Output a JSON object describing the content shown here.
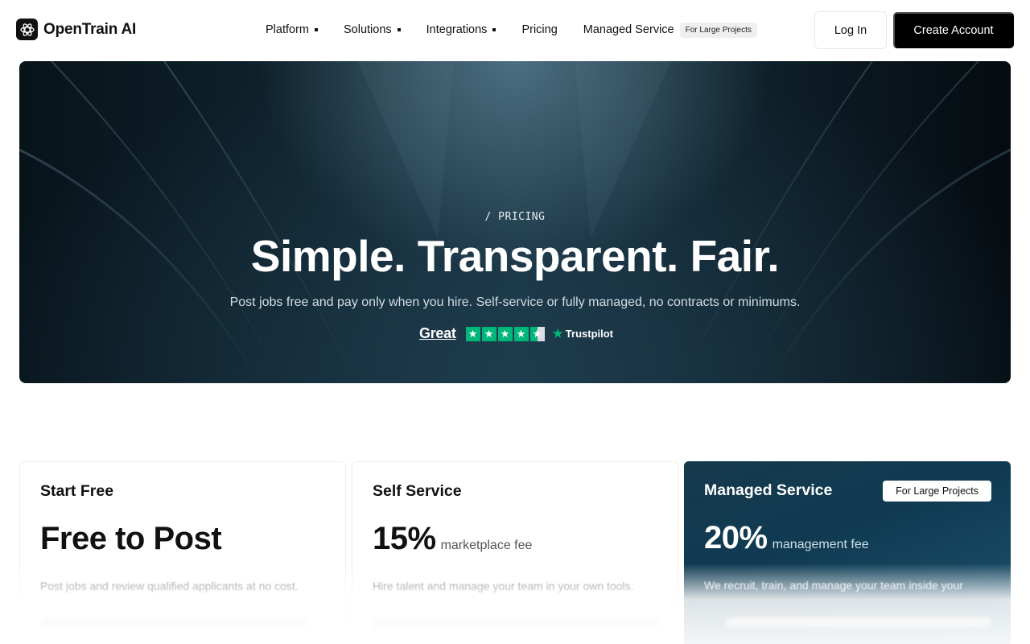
{
  "nav": {
    "brand": "OpenTrain AI",
    "menu": [
      {
        "label": "Platform"
      },
      {
        "label": "Solutions"
      },
      {
        "label": "Integrations"
      },
      {
        "label": "Pricing"
      },
      {
        "label": "Managed Service",
        "badge": "For Large Projects"
      }
    ],
    "login_label": "Log In",
    "create_label": "Create Account"
  },
  "hero": {
    "eyebrow": "/ PRICING",
    "title": "Simple. Transparent. Fair.",
    "subtitle": "Post jobs free and pay only when you hire. Self-service or fully managed, no contracts or minimums.",
    "rating_word": "Great",
    "rating_stars": 4.5,
    "trust_brand": "Trustpilot"
  },
  "plans": [
    {
      "title": "Start Free",
      "price": "Free to Post",
      "unit": "",
      "desc": "Post jobs and review qualified applicants at no cost."
    },
    {
      "title": "Self Service",
      "price": "15%",
      "unit": "marketplace fee",
      "desc": "Hire talent and manage your team in your own tools."
    },
    {
      "title": "Managed Service",
      "price": "20%",
      "unit": "management fee",
      "desc": "We recruit, train, and manage your team inside your",
      "badge": "For Large Projects"
    }
  ],
  "colors": {
    "primary_button": "#000000",
    "trustpilot_green": "#00b67a",
    "managed_card": "#0f3a52"
  }
}
